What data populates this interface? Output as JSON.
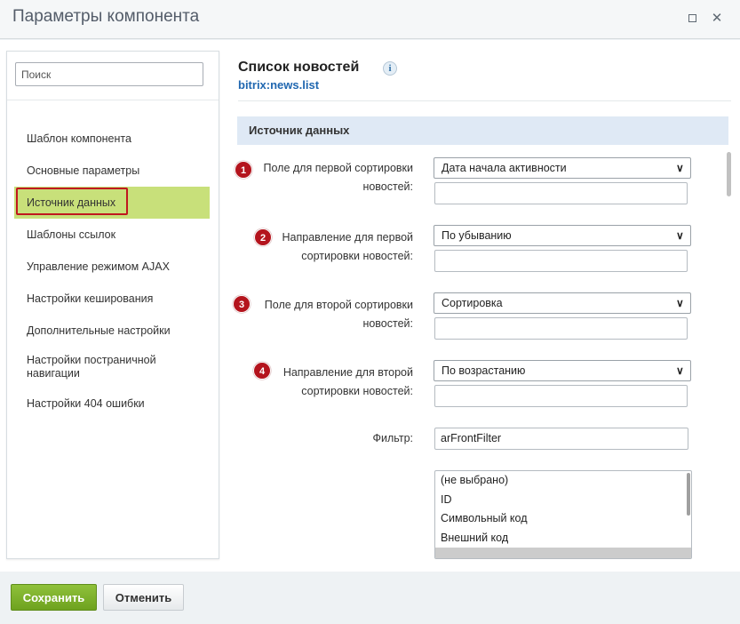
{
  "window": {
    "title": "Параметры компонента"
  },
  "sidebar": {
    "search_placeholder": "Поиск",
    "items": [
      {
        "label": "Шаблон компонента"
      },
      {
        "label": "Основные параметры"
      },
      {
        "label": "Источник данных",
        "active": true
      },
      {
        "label": "Шаблоны ссылок"
      },
      {
        "label": "Управление режимом AJAX"
      },
      {
        "label": "Настройки кеширования"
      },
      {
        "label": "Дополнительные настройки"
      },
      {
        "label": "Настройки постраничной навигации"
      },
      {
        "label": "Настройки 404 ошибки"
      }
    ]
  },
  "component": {
    "title": "Список новостей",
    "code": "bitrix:news.list"
  },
  "section": {
    "title": "Источник данных"
  },
  "params": [
    {
      "badge": "1",
      "label": "Поле для первой сортировки новостей:",
      "value": "Дата начала активности"
    },
    {
      "badge": "2",
      "label": "Направление для первой сортировки новостей:",
      "value": "По убыванию"
    },
    {
      "badge": "3",
      "label": "Поле для второй сортировки новостей:",
      "value": "Сортировка"
    },
    {
      "badge": "4",
      "label": "Направление для второй сортировки новостей:",
      "value": "По возрастанию"
    }
  ],
  "filter": {
    "label": "Фильтр:",
    "value": "arFrontFilter"
  },
  "field_list": {
    "options": [
      "(не выбрано)",
      "ID",
      "Символьный код",
      "Внешний код"
    ]
  },
  "footer": {
    "save_label": "Сохранить",
    "cancel_label": "Отменить"
  },
  "colors": {
    "active_item_bg": "#c8e07a",
    "highlight_border": "#c0171e",
    "badge_bg": "#b4141d",
    "section_head_bg": "#dfe9f5",
    "code_link": "#2067b0",
    "save_button": "#7ab22b"
  }
}
